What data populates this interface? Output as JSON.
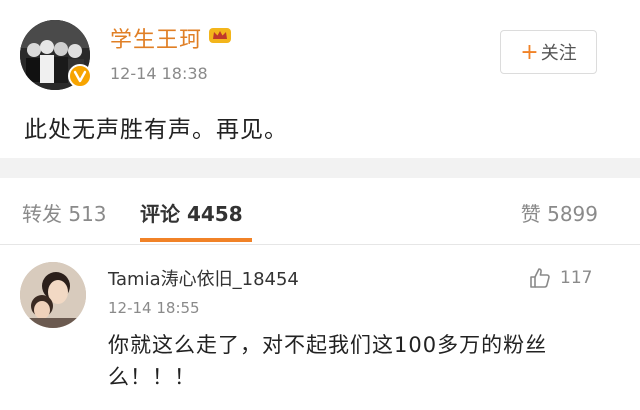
{
  "post": {
    "username": "学生王珂",
    "timestamp": "12-14 18:38",
    "follow_label": "关注",
    "follow_icon": "plus-icon",
    "text": "此处无声胜有声。再见。",
    "badge_icon": "crown-icon",
    "verified_icon": "verified-v-icon"
  },
  "tabs": {
    "repost_label": "转发",
    "repost_count": "513",
    "comments_label": "评论",
    "comments_count": "4458",
    "likes_label": "赞",
    "likes_count": "5899"
  },
  "comment": {
    "username": "Tamia涛心依旧_18454",
    "timestamp": "12-14 18:55",
    "text": "你就这么走了，对不起我们这100多万的粉丝么！！！",
    "like_count": "117",
    "like_icon": "thumbs-up-icon"
  },
  "colors": {
    "accent": "#f18227",
    "username": "#e07f25",
    "muted": "#8a8a8a",
    "separator": "#f2f2f2"
  }
}
